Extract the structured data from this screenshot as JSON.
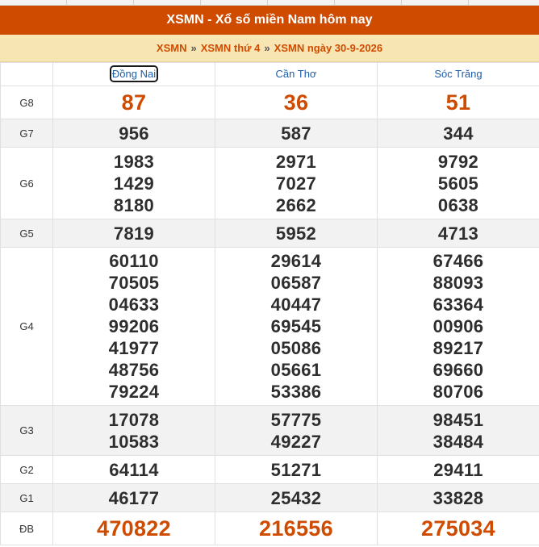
{
  "header": {
    "title": "XSMN - Xổ số miền Nam hôm nay"
  },
  "breadcrumb": [
    "XSMN",
    "XSMN thứ 4",
    "XSMN ngày 30-9-2026"
  ],
  "breadcrumb_sep": "»",
  "provinces": [
    "Đồng Nai",
    "Cần Thơ",
    "Sóc Trăng"
  ],
  "prizes": [
    {
      "label": "G8",
      "values": [
        [
          "87"
        ],
        [
          "36"
        ],
        [
          "51"
        ]
      ]
    },
    {
      "label": "G7",
      "values": [
        [
          "956"
        ],
        [
          "587"
        ],
        [
          "344"
        ]
      ]
    },
    {
      "label": "G6",
      "values": [
        [
          "1983",
          "1429",
          "8180"
        ],
        [
          "2971",
          "7027",
          "2662"
        ],
        [
          "9792",
          "5605",
          "0638"
        ]
      ]
    },
    {
      "label": "G5",
      "values": [
        [
          "7819"
        ],
        [
          "5952"
        ],
        [
          "4713"
        ]
      ]
    },
    {
      "label": "G4",
      "values": [
        [
          "60110",
          "70505",
          "04633",
          "99206",
          "41977",
          "48756",
          "79224"
        ],
        [
          "29614",
          "06587",
          "40447",
          "69545",
          "05086",
          "05661",
          "53386"
        ],
        [
          "67466",
          "88093",
          "63364",
          "00906",
          "89217",
          "69660",
          "80706"
        ]
      ]
    },
    {
      "label": "G3",
      "values": [
        [
          "17078",
          "10583"
        ],
        [
          "57775",
          "49227"
        ],
        [
          "98451",
          "38484"
        ]
      ]
    },
    {
      "label": "G2",
      "values": [
        [
          "64114"
        ],
        [
          "51271"
        ],
        [
          "29411"
        ]
      ]
    },
    {
      "label": "G1",
      "values": [
        [
          "46177"
        ],
        [
          "25432"
        ],
        [
          "33828"
        ]
      ]
    },
    {
      "label": "ĐB",
      "values": [
        [
          "470822"
        ],
        [
          "216556"
        ],
        [
          "275034"
        ]
      ]
    }
  ],
  "colors": {
    "accent": "#cf4b00",
    "crumb_bg": "#f7e6b4",
    "link": "#1b5eaa"
  }
}
